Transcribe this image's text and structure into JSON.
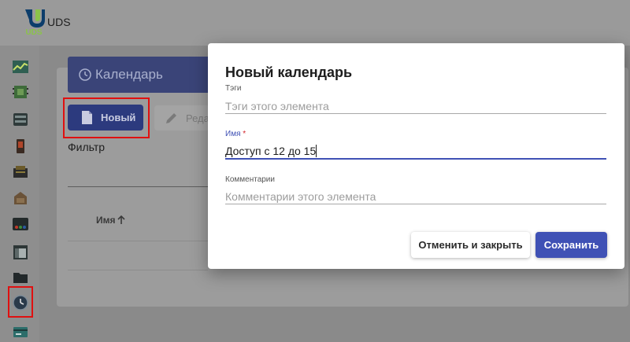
{
  "app": {
    "title": "UDS",
    "logo_text": "UDS"
  },
  "sidebar": {
    "icons": [
      {
        "icon": "chart-dashboard-icon"
      },
      {
        "icon": "chip-service-provider-icon"
      },
      {
        "icon": "server-icon"
      },
      {
        "icon": "authenticator-icon"
      },
      {
        "icon": "os-manager-icon"
      },
      {
        "icon": "transport-icon"
      },
      {
        "icon": "networks-icon"
      },
      {
        "icon": "window-icon"
      },
      {
        "icon": "folder-icon"
      },
      {
        "icon": "clock-calendar-icon",
        "highlighted": true
      },
      {
        "icon": "account-card-icon"
      }
    ]
  },
  "page": {
    "title": "Календарь",
    "toolbar": {
      "new_label": "Новый",
      "edit_label": "Реда"
    },
    "filter_label": "Фильтр",
    "table": {
      "column_name": "Имя"
    }
  },
  "dialog": {
    "title": "Новый календарь",
    "fields": {
      "tags": {
        "label": "Тэги",
        "placeholder": "Тэги этого элемента",
        "value": ""
      },
      "name": {
        "label": "Имя",
        "required_mark": "*",
        "value": "Доступ с 12 до 15"
      },
      "comments": {
        "label": "Комментарии",
        "placeholder": "Комментарии этого элемента",
        "value": ""
      }
    },
    "buttons": {
      "cancel": "Отменить и закрыть",
      "save": "Сохранить"
    }
  },
  "colors": {
    "primary": "#3f51b5",
    "highlight_red": "#e01010",
    "overlay_grey": "#8a8a8a"
  }
}
